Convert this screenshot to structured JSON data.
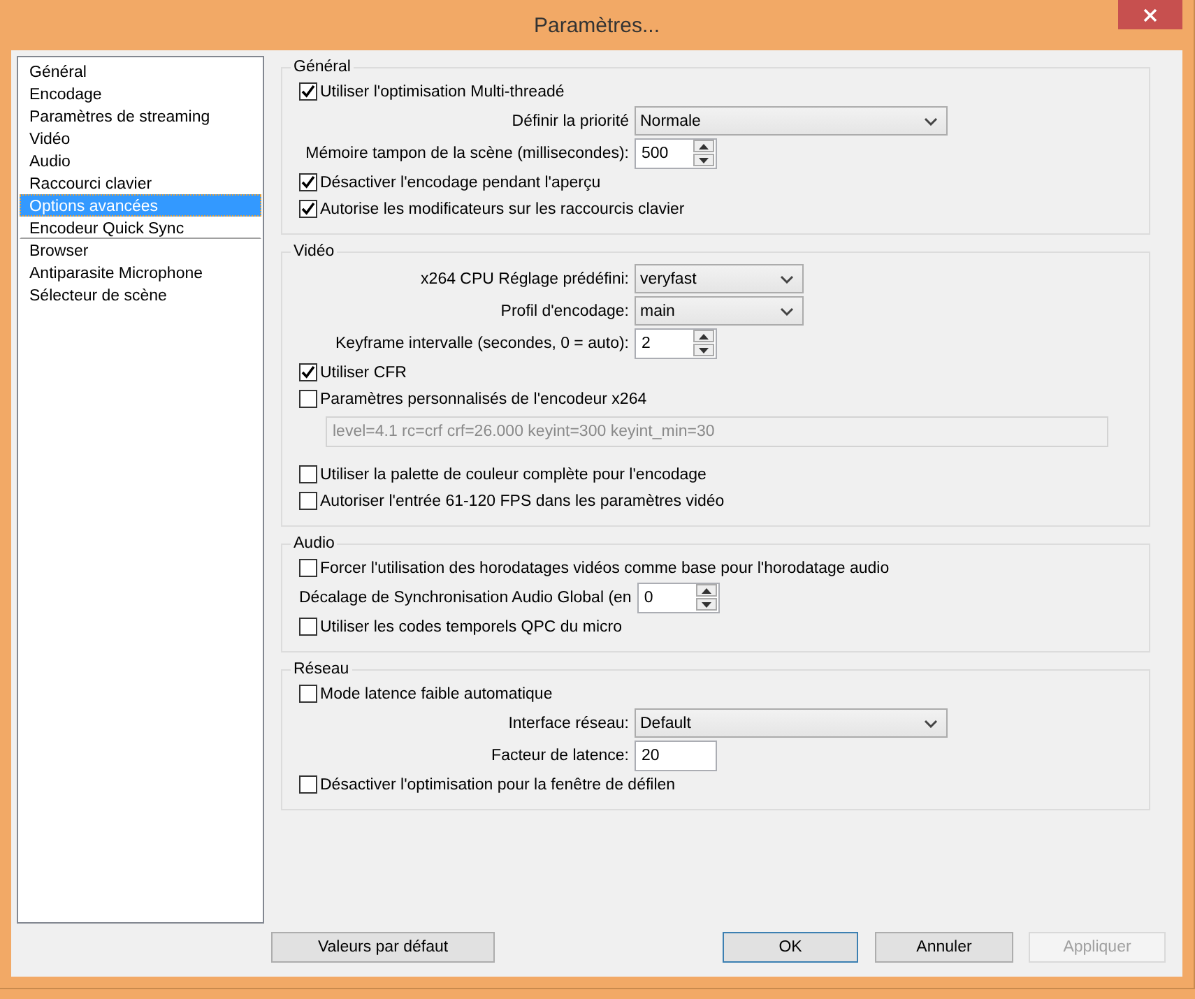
{
  "window": {
    "title": "Paramètres..."
  },
  "sidebar": {
    "items": [
      {
        "label": "Général",
        "selected": false,
        "divider_after": false
      },
      {
        "label": "Encodage",
        "selected": false,
        "divider_after": false
      },
      {
        "label": "Paramètres de streaming",
        "selected": false,
        "divider_after": false
      },
      {
        "label": "Vidéo",
        "selected": false,
        "divider_after": false
      },
      {
        "label": "Audio",
        "selected": false,
        "divider_after": false
      },
      {
        "label": "Raccourci clavier",
        "selected": false,
        "divider_after": false
      },
      {
        "label": "Options avancées",
        "selected": true,
        "divider_after": false
      },
      {
        "label": "Encodeur Quick Sync",
        "selected": false,
        "divider_after": true
      },
      {
        "label": "Browser",
        "selected": false,
        "divider_after": false
      },
      {
        "label": "Antiparasite Microphone",
        "selected": false,
        "divider_after": false
      },
      {
        "label": "Sélecteur de scène",
        "selected": false,
        "divider_after": false
      }
    ]
  },
  "sections": [
    {
      "title": "Général",
      "rows": [
        {
          "kind": "checkbox",
          "label": "Utiliser l'optimisation Multi-threadé",
          "checked": true
        },
        {
          "kind": "select",
          "label": "Définir la priorité",
          "value": "Normale",
          "wide": true
        },
        {
          "kind": "spin",
          "label": "Mémoire tampon de la scène (millisecondes):",
          "value": "500"
        },
        {
          "kind": "checkbox",
          "label": "Désactiver l'encodage pendant l'aperçu",
          "checked": true
        },
        {
          "kind": "checkbox",
          "label": "Autorise les modificateurs sur les raccourcis clavier",
          "checked": true
        }
      ]
    },
    {
      "title": "Vidéo",
      "rows": [
        {
          "kind": "select",
          "label": "x264 CPU Réglage prédéfini:",
          "value": "veryfast",
          "wide": false
        },
        {
          "kind": "select",
          "label": "Profil d'encodage:",
          "value": "main",
          "wide": false
        },
        {
          "kind": "spin",
          "label": "Keyframe intervalle (secondes, 0 = auto):",
          "value": "2"
        },
        {
          "kind": "checkbox",
          "label": "Utiliser CFR",
          "checked": true
        },
        {
          "kind": "checkbox",
          "label": "Paramètres personnalisés de l'encodeur x264",
          "checked": false
        },
        {
          "kind": "entry",
          "value": "level=4.1 rc=crf crf=26.000 keyint=300 keyint_min=30",
          "disabled": true
        },
        {
          "kind": "checkbox",
          "label": "Utiliser la palette de couleur complète pour l'encodage",
          "checked": false
        },
        {
          "kind": "checkbox",
          "label": "Autoriser l'entrée 61-120 FPS dans les paramètres vidéo",
          "checked": false
        }
      ]
    },
    {
      "title": "Audio",
      "rows": [
        {
          "kind": "checkbox",
          "label": "Forcer l'utilisation des horodatages vidéos comme base pour l'horodatage audio",
          "checked": false
        },
        {
          "kind": "spin",
          "label": "Décalage de Synchronisation Audio Global (en",
          "value": "0"
        },
        {
          "kind": "checkbox",
          "label": "Utiliser les codes temporels QPC du micro",
          "checked": false
        }
      ]
    },
    {
      "title": "Réseau",
      "rows": [
        {
          "kind": "checkbox",
          "label": "Mode latence faible automatique",
          "checked": false
        },
        {
          "kind": "select",
          "label": "Interface réseau:",
          "value": "Default",
          "wide": true
        },
        {
          "kind": "text",
          "label": "Facteur de latence:",
          "value": "20"
        },
        {
          "kind": "checkbox",
          "label": "Désactiver l'optimisation pour la fenêtre de défilen",
          "checked": false
        }
      ]
    }
  ],
  "buttons": [
    {
      "label": "Valeurs par défaut",
      "default": false,
      "disabled": false
    },
    {
      "label": "OK",
      "default": true,
      "disabled": false
    },
    {
      "label": "Annuler",
      "default": false,
      "disabled": false
    },
    {
      "label": "Appliquer",
      "default": false,
      "disabled": true
    }
  ]
}
